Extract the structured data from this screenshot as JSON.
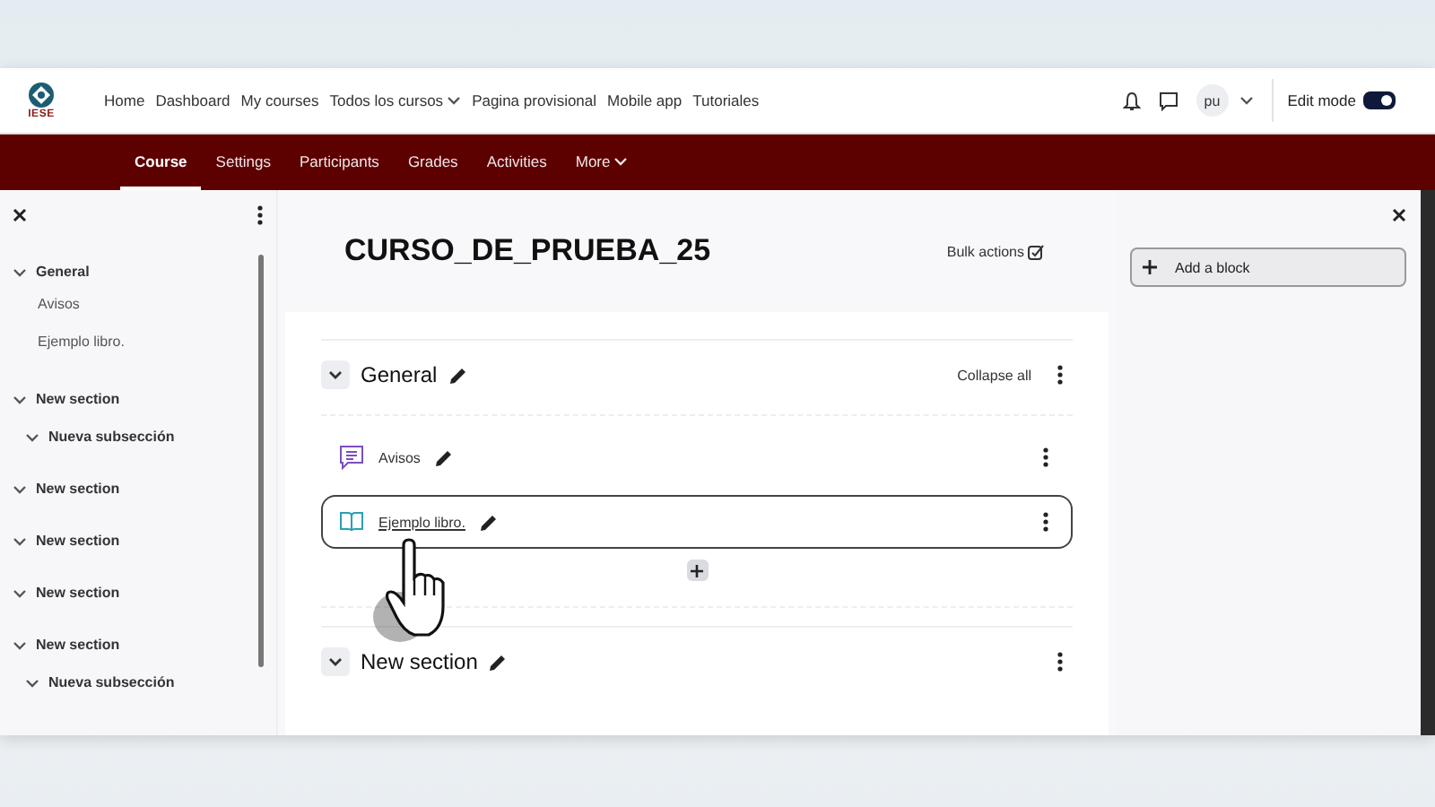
{
  "navbar": {
    "logo_text": "IESE",
    "links": [
      {
        "label": "Home",
        "dropdown": false
      },
      {
        "label": "Dashboard",
        "dropdown": false
      },
      {
        "label": "My courses",
        "dropdown": false
      },
      {
        "label": "Todos los cursos",
        "dropdown": true
      },
      {
        "label": "Pagina provisional",
        "dropdown": false
      },
      {
        "label": "Mobile app",
        "dropdown": false
      },
      {
        "label": "Tutoriales",
        "dropdown": false
      }
    ],
    "avatar": "pu",
    "edit_mode": {
      "label": "Edit mode",
      "on": true
    }
  },
  "tabs": [
    {
      "label": "Course",
      "selected": true,
      "dropdown": false
    },
    {
      "label": "Settings",
      "selected": false,
      "dropdown": false
    },
    {
      "label": "Participants",
      "selected": false,
      "dropdown": false
    },
    {
      "label": "Grades",
      "selected": false,
      "dropdown": false
    },
    {
      "label": "Activities",
      "selected": false,
      "dropdown": false
    },
    {
      "label": "More",
      "selected": false,
      "dropdown": true
    }
  ],
  "course_index": [
    {
      "label": "General",
      "expanded": true,
      "children": [
        {
          "label": "Avisos"
        },
        {
          "label": "Ejemplo libro."
        }
      ]
    },
    {
      "label": "New section",
      "expanded": true,
      "children": [
        {
          "label": "Nueva subsección",
          "expanded": true
        }
      ]
    },
    {
      "label": "New section",
      "expanded": true
    },
    {
      "label": "New section",
      "expanded": true
    },
    {
      "label": "New section",
      "expanded": true
    },
    {
      "label": "New section",
      "expanded": true,
      "children": [
        {
          "label": "Nueva subsección",
          "expanded": true
        }
      ]
    }
  ],
  "course": {
    "title": "CURSO_DE_PRUEBA_25",
    "bulk_actions": "Bulk actions",
    "collapse_all": "Collapse all",
    "sections": [
      {
        "title": "General",
        "expanded": true,
        "activities": [
          {
            "kind": "forum",
            "name": "Avisos",
            "highlighted": false
          },
          {
            "kind": "book",
            "name": "Ejemplo libro.",
            "highlighted": true
          }
        ]
      },
      {
        "title": "New section",
        "expanded": true
      }
    ]
  },
  "blocks": {
    "add_block": "Add a block"
  }
}
